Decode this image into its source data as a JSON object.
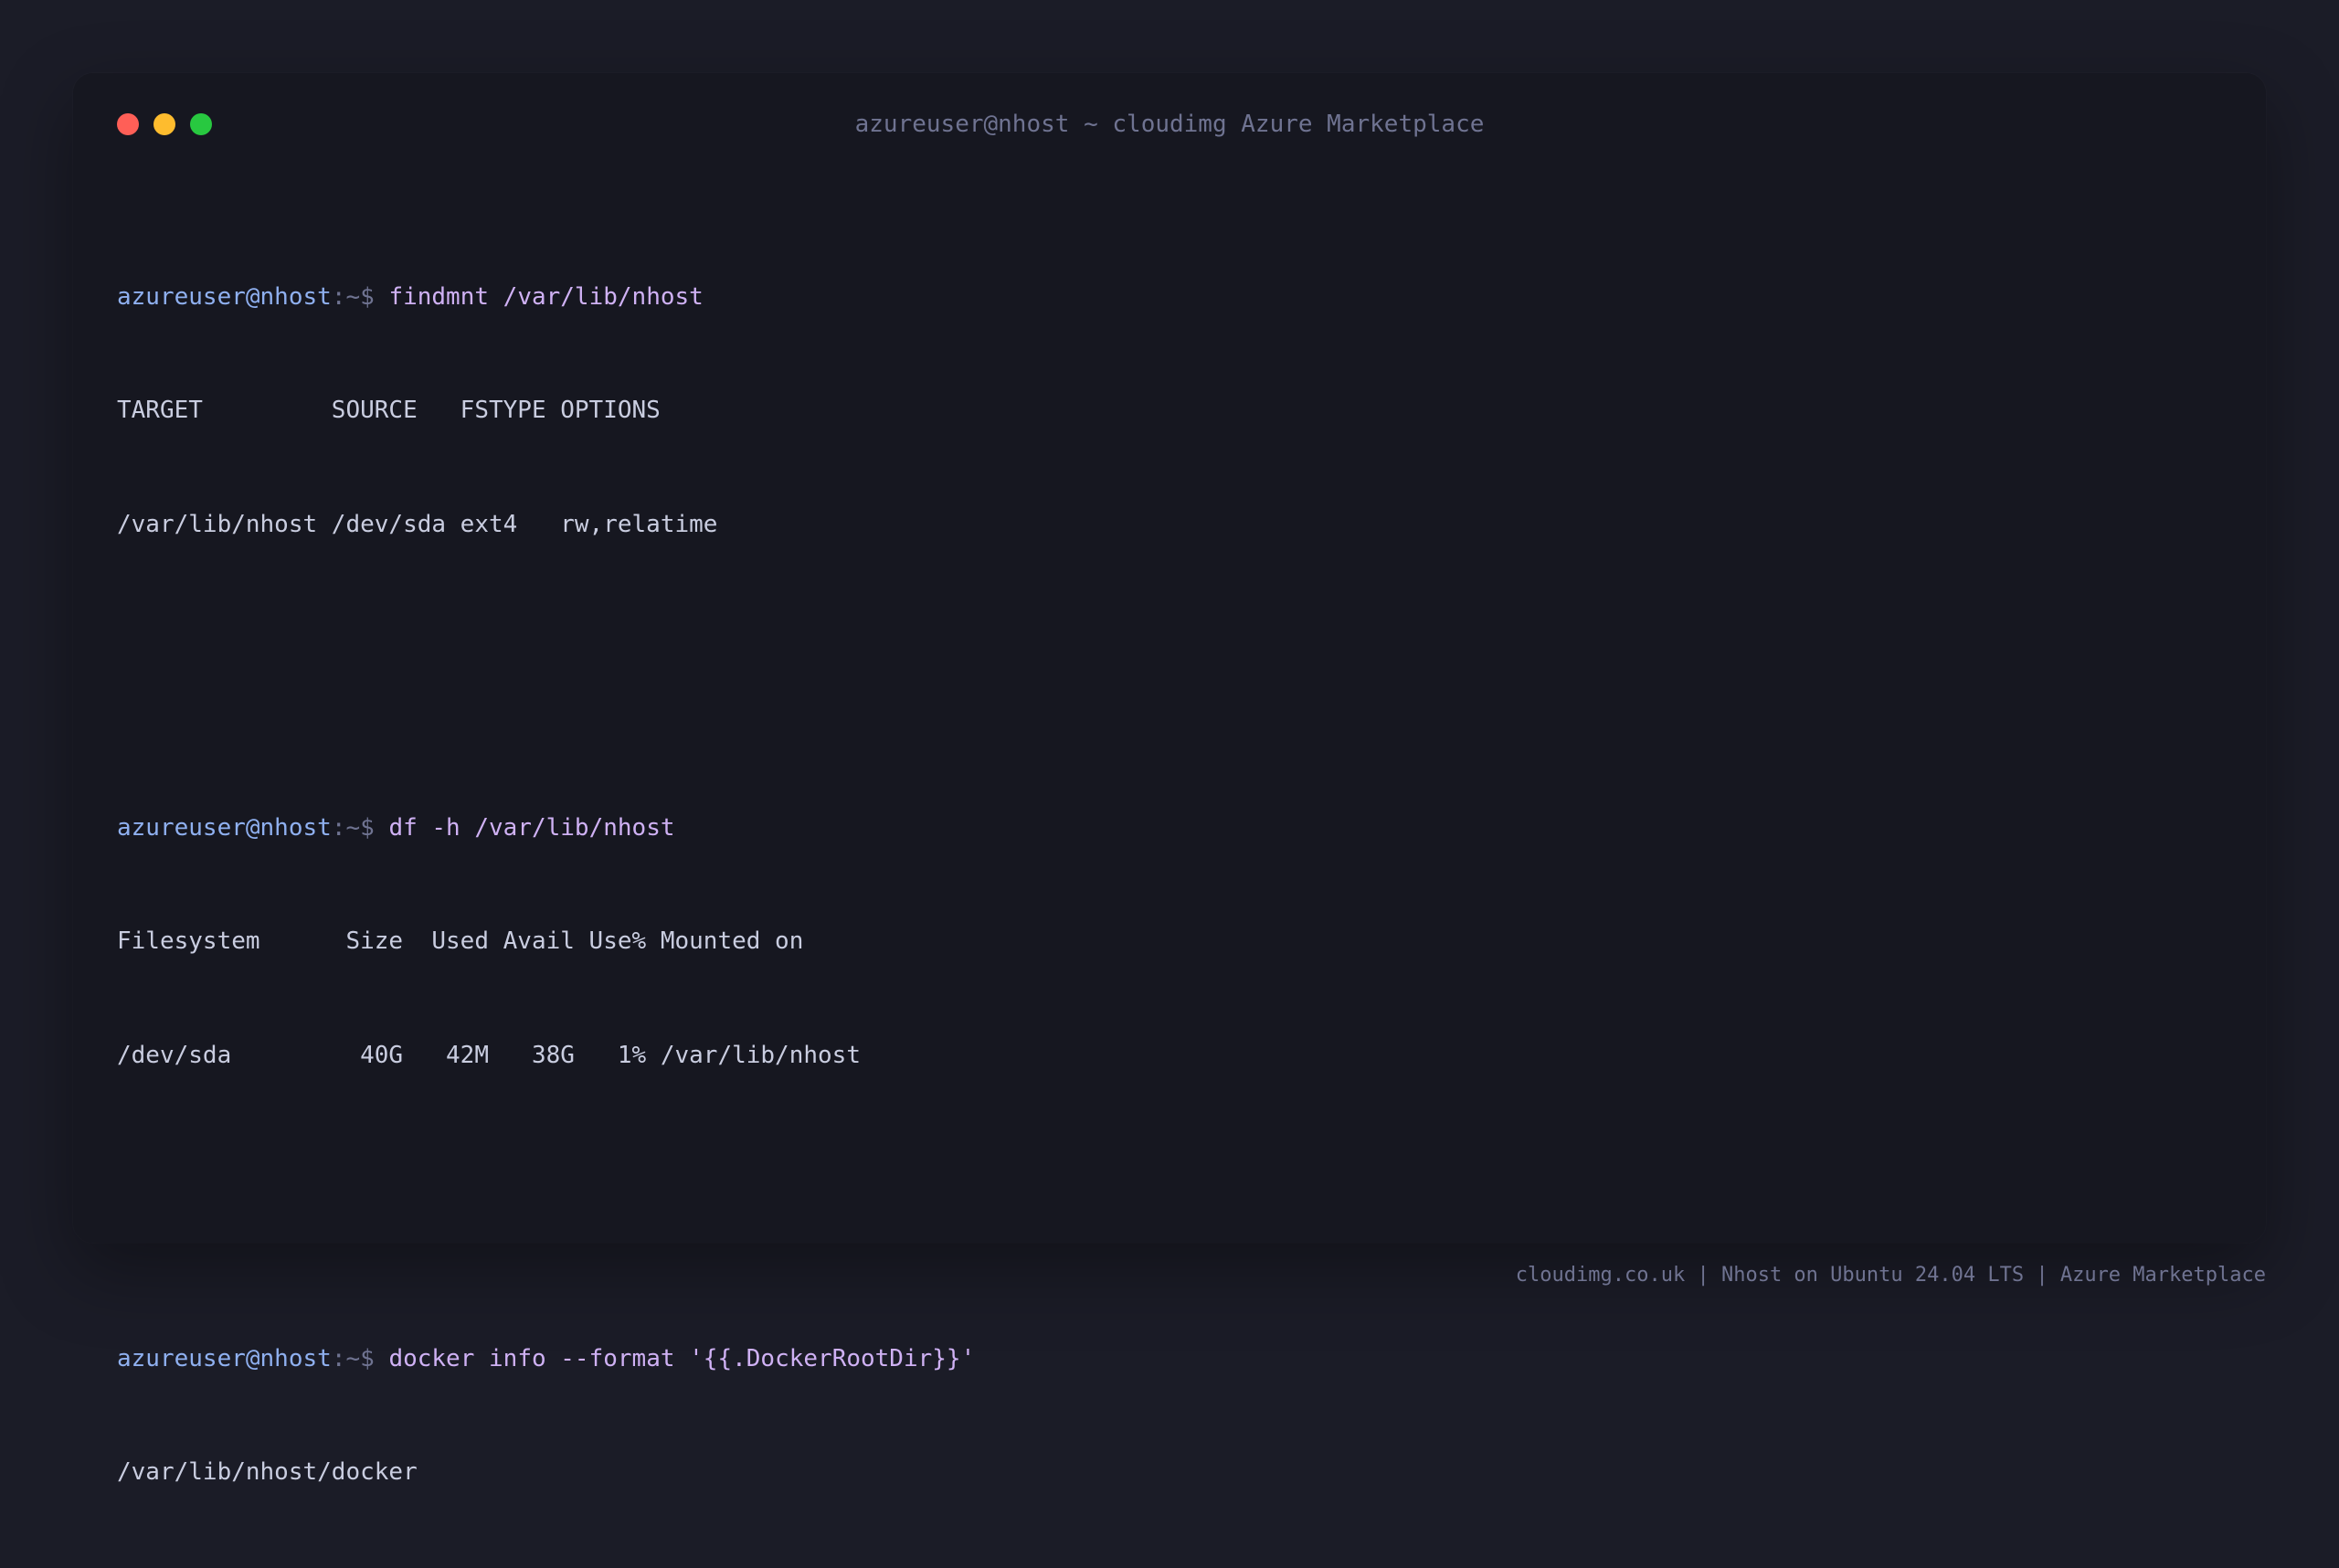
{
  "window": {
    "title": "azureuser@nhost ~ cloudimg Azure Marketplace"
  },
  "prompt": {
    "user_host": "azureuser@nhost",
    "path_symbol": ":~$"
  },
  "sessions": [
    {
      "command": "findmnt /var/lib/nhost",
      "output": [
        "TARGET         SOURCE   FSTYPE OPTIONS",
        "/var/lib/nhost /dev/sda ext4   rw,relatime"
      ]
    },
    {
      "command": "df -h /var/lib/nhost",
      "output": [
        "Filesystem      Size  Used Avail Use% Mounted on",
        "/dev/sda         40G   42M   38G   1% /var/lib/nhost"
      ]
    },
    {
      "command": "docker info --format '{{.DockerRootDir}}'",
      "output": [
        "/var/lib/nhost/docker"
      ]
    }
  ],
  "footer": {
    "text": "cloudimg.co.uk | Nhost on Ubuntu 24.04 LTS | Azure Marketplace"
  },
  "colors": {
    "background": "#1b1c27",
    "window": "#161720",
    "prompt_user": "#8fb0f0",
    "prompt_path": "#6f7391",
    "command": "#cfb1f4",
    "output": "#c9cde0",
    "close": "#ff5f57",
    "minimize": "#febc2e",
    "maximize": "#28c840"
  }
}
